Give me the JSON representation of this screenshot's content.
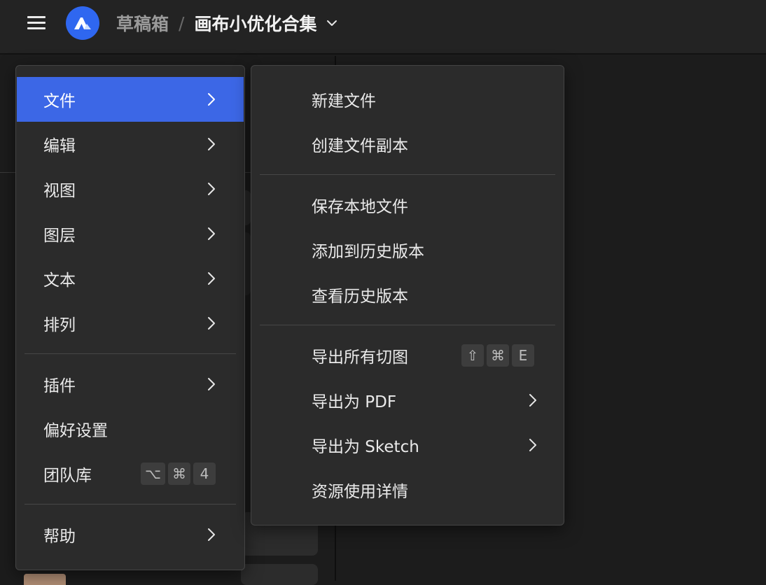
{
  "header": {
    "breadcrumb_parent": "草稿箱",
    "breadcrumb_separator": "/",
    "file_title": "画布小优化合集"
  },
  "menu": {
    "items": [
      {
        "label": "文件",
        "active": true,
        "has_submenu": true
      },
      {
        "label": "编辑",
        "has_submenu": true
      },
      {
        "label": "视图",
        "has_submenu": true
      },
      {
        "label": "图层",
        "has_submenu": true
      },
      {
        "label": "文本",
        "has_submenu": true
      },
      {
        "label": "排列",
        "has_submenu": true
      },
      {
        "label": "插件",
        "has_submenu": true
      },
      {
        "label": "偏好设置"
      },
      {
        "label": "团队库",
        "shortcut": [
          "⌥",
          "⌘",
          "4"
        ]
      },
      {
        "label": "帮助",
        "has_submenu": true
      }
    ]
  },
  "submenu": {
    "items": [
      {
        "label": "新建文件"
      },
      {
        "label": "创建文件副本"
      },
      {
        "label": "保存本地文件"
      },
      {
        "label": "添加到历史版本"
      },
      {
        "label": "查看历史版本"
      },
      {
        "label": "导出所有切图",
        "shortcut": [
          "⇧",
          "⌘",
          "E"
        ]
      },
      {
        "label": "导出为 PDF",
        "has_submenu": true
      },
      {
        "label": "导出为 Sketch",
        "has_submenu": true
      },
      {
        "label": "资源使用详情"
      }
    ]
  },
  "colors": {
    "accent": "#3c67e6",
    "logo": "#2f67f0",
    "menu_bg": "#2b2b2b",
    "topbar_bg": "#232323"
  }
}
